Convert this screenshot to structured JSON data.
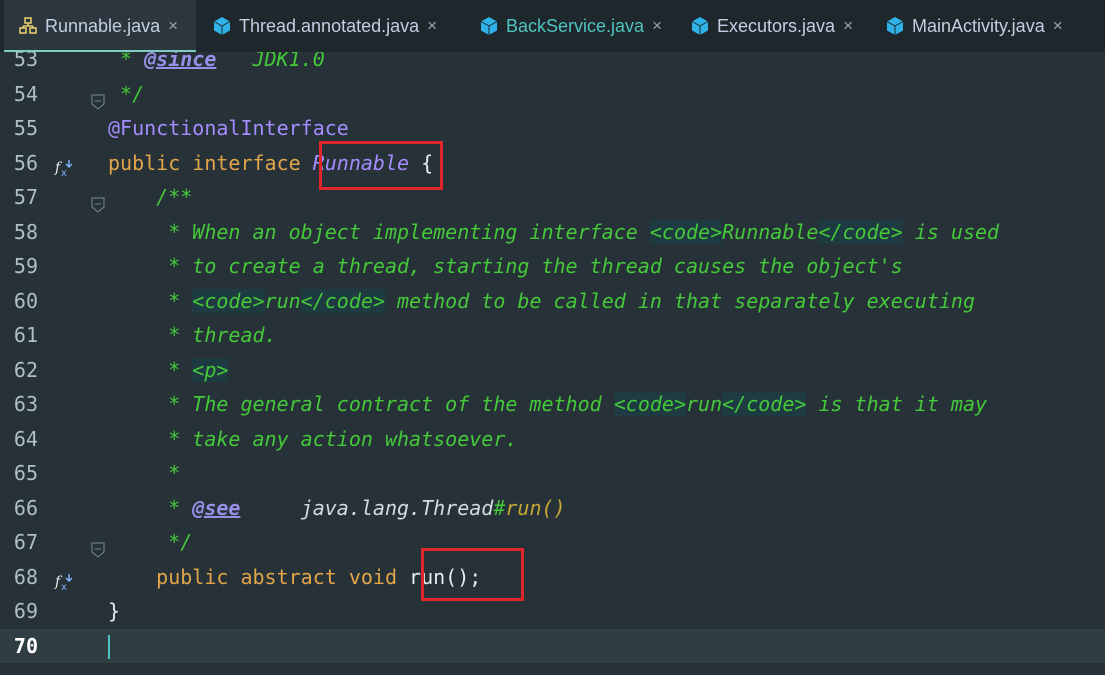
{
  "tabs": [
    {
      "label": "Runnable.java",
      "icon": "interface-structure-icon",
      "active": true
    },
    {
      "label": "Thread.annotated.java",
      "icon": "java-class-cube-icon"
    },
    {
      "label": "BackService.java",
      "icon": "java-class-cube-icon"
    },
    {
      "label": "Executors.java",
      "icon": "java-class-cube-icon"
    },
    {
      "label": "MainActivity.java",
      "icon": "java-class-cube-icon"
    }
  ],
  "close_glyph": "×",
  "lines": [
    {
      "n": "53",
      "t": [
        [
          "cm",
          " * "
        ],
        [
          "see",
          "@since"
        ],
        [
          "cm",
          "   JDK1.0"
        ]
      ]
    },
    {
      "n": "54",
      "t": [
        [
          "cm",
          " */"
        ]
      ]
    },
    {
      "n": "55",
      "t": [
        [
          "ann",
          "@FunctionalInterface"
        ]
      ]
    },
    {
      "n": "56",
      "t": [
        [
          "kw",
          "public interface "
        ],
        [
          "typ",
          "Runnable"
        ],
        [
          "plain",
          " {"
        ]
      ]
    },
    {
      "n": "57",
      "t": [
        [
          "cm",
          "    /**"
        ]
      ]
    },
    {
      "n": "58",
      "t": [
        [
          "cm",
          "     * When an object implementing interface "
        ],
        [
          "tag",
          "<code>"
        ],
        [
          "cm",
          "Runnable"
        ],
        [
          "tag",
          "</code>"
        ],
        [
          "cm",
          " is used"
        ]
      ]
    },
    {
      "n": "59",
      "t": [
        [
          "cm",
          "     * to create a thread, starting the thread causes the object's"
        ]
      ]
    },
    {
      "n": "60",
      "t": [
        [
          "cm",
          "     * "
        ],
        [
          "tag",
          "<code>"
        ],
        [
          "cm",
          "run"
        ],
        [
          "tag",
          "</code>"
        ],
        [
          "cm",
          " method to be called in that separately executing"
        ]
      ]
    },
    {
      "n": "61",
      "t": [
        [
          "cm",
          "     * thread."
        ]
      ]
    },
    {
      "n": "62",
      "t": [
        [
          "cm",
          "     * "
        ],
        [
          "tag",
          "<p>"
        ]
      ]
    },
    {
      "n": "63",
      "t": [
        [
          "cm",
          "     * The general contract of the method "
        ],
        [
          "tag",
          "<code>"
        ],
        [
          "cm",
          "run"
        ],
        [
          "tag",
          "</code>"
        ],
        [
          "cm",
          " is that it may"
        ]
      ]
    },
    {
      "n": "64",
      "t": [
        [
          "cm",
          "     * take any action whatsoever."
        ]
      ]
    },
    {
      "n": "65",
      "t": [
        [
          "cm",
          "     *"
        ]
      ]
    },
    {
      "n": "66",
      "t": [
        [
          "cm",
          "     * "
        ],
        [
          "see",
          "@see"
        ],
        [
          "cm",
          "     "
        ],
        [
          "ref",
          "java.lang.Thread"
        ],
        [
          "cm",
          "#"
        ],
        [
          "refm",
          "run()"
        ]
      ]
    },
    {
      "n": "67",
      "t": [
        [
          "cm",
          "     */"
        ]
      ]
    },
    {
      "n": "68",
      "t": [
        [
          "kw",
          "    public abstract void "
        ],
        [
          "plain",
          "run();"
        ]
      ]
    },
    {
      "n": "69",
      "t": [
        [
          "plain",
          "}"
        ]
      ]
    },
    {
      "n": "70",
      "t": []
    }
  ],
  "gutter": {
    "implemented_icon_lines": [
      "56",
      "68"
    ],
    "fold_icon_lines": [
      "54",
      "57",
      "67"
    ],
    "current_line": "70"
  },
  "highlights": [
    "Runnable",
    "run();"
  ],
  "colors": {
    "background": "#263238",
    "keyword": "#e2a54a",
    "comment": "#45c83a",
    "annotation": "#a58cff",
    "highlight": "#e0262b",
    "accent": "#80cbc4"
  }
}
